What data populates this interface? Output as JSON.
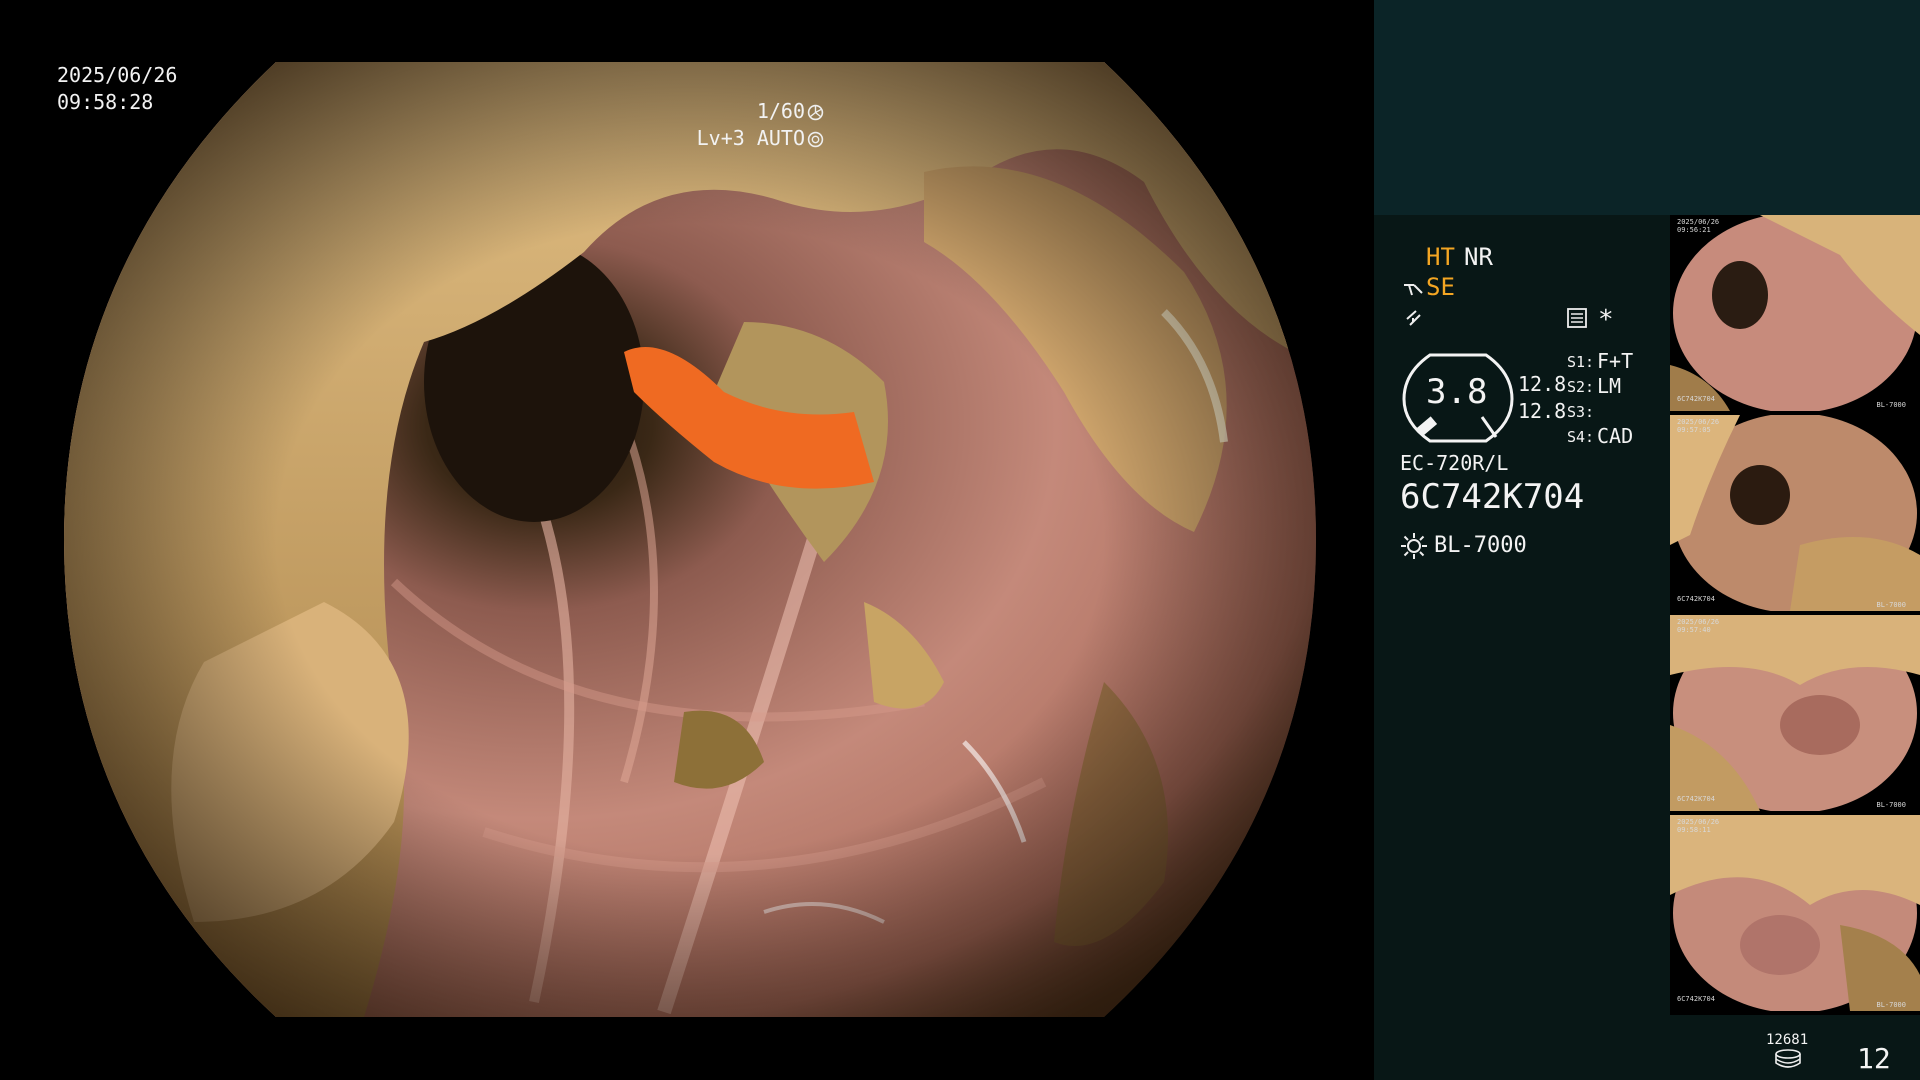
{
  "osd": {
    "date": "2025/06/26",
    "time": "09:58:28",
    "shutter": "1/60",
    "shutter_icon": "aperture-icon",
    "level": "Lv+3",
    "mode": "AUTO",
    "mode_icon": "target-icon"
  },
  "panel": {
    "ht": "HT",
    "nr": "NR",
    "se": "SE",
    "se_icon": "probe-icon",
    "lightning_icon": "flash-icon",
    "settings_icon": "document-list-icon",
    "asterisk": "*",
    "gauge_value": "3.8",
    "gauge_right_1": "12.8",
    "gauge_right_2": "12.8",
    "s1_label": "S1:",
    "s1_value": "F+T",
    "s2_label": "S2:",
    "s2_value": "LM",
    "s3_label": "S3:",
    "s3_value": "",
    "s4_label": "S4:",
    "s4_value": "CAD",
    "scope_model": "EC-720R/L",
    "scope_serial": "6C742K704",
    "light_source": "BL-7000",
    "light_icon": "sun-icon"
  },
  "thumbnails": [
    {
      "date": "2025/06/26",
      "time": "09:56:21",
      "serial": "6C742K704",
      "source": "BL-7000"
    },
    {
      "date": "2025/06/26",
      "time": "09:57:05",
      "serial": "6C742K704",
      "source": "BL-7000"
    },
    {
      "date": "2025/06/26",
      "time": "09:57:40",
      "serial": "6C742K704",
      "source": "BL-7000"
    },
    {
      "date": "2025/06/26",
      "time": "09:58:11",
      "serial": "6C742K704",
      "source": "BL-7000"
    }
  ],
  "storage": {
    "capacity": "12681",
    "count": "12",
    "icon": "disk-stack-icon"
  },
  "colors": {
    "accent": "#f4a623",
    "panel_top": "#0b2427",
    "panel_info": "#081716",
    "mucosa": "#c98f7c",
    "residue": "#c7a063"
  }
}
